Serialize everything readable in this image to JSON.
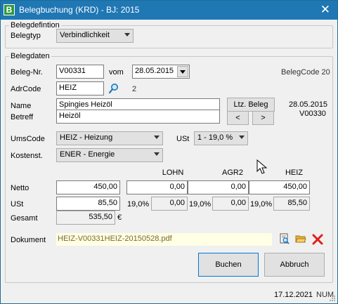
{
  "window": {
    "title": "Belegbuchung (KRD) - BJ: 2015",
    "close_glyph": "✕",
    "app_icon_letter": "B"
  },
  "belegdefinition": {
    "group_label": "Belegdefintion",
    "belegtyp_label": "Belegtyp",
    "belegtyp_value": "Verbindlichkeit"
  },
  "belegdaten": {
    "group_label": "Belegdaten",
    "belegnr_label": "Beleg-Nr.",
    "belegnr_value": "V00331",
    "vom_label": "vom",
    "vom_value": "28.05.2015",
    "belegcode": "BelegCode 20",
    "adrcode_label": "AdrCode",
    "adrcode_value": "HEIZ",
    "adrcode_count": "2",
    "name_label": "Name",
    "name_value": "Spingies Heizöl",
    "ltz_beleg_label": "Ltz. Beleg",
    "ltz_date": "28.05.2015",
    "ltz_nr": "V00330",
    "betreff_label": "Betreff",
    "betreff_value": "Heizöl",
    "prev_label": "<",
    "next_label": ">",
    "umscode_label": "UmsCode",
    "umscode_value": "HEIZ - Heizung",
    "ust_label": "USt",
    "ust_value": "1 - 19,0 %",
    "kostenst_label": "Kostenst.",
    "kostenst_value": "ENER - Energie",
    "columns": [
      "LOHN",
      "AGR2",
      "HEIZ"
    ],
    "netto_label": "Netto",
    "netto_total": "450,00",
    "netto_values": [
      "0,00",
      "0,00",
      "450,00"
    ],
    "ust_row_label": "USt",
    "ust_total": "85,50",
    "ust_rates": [
      "19,0%",
      "19,0%",
      "19,0%"
    ],
    "ust_values": [
      "0,00",
      "0,00",
      "85,50"
    ],
    "gesamt_label": "Gesamt",
    "gesamt_value": "535,50",
    "currency": "€",
    "dokument_label": "Dokument",
    "dokument_value": "HEIZ-V00331HEIZ-20150528.pdf"
  },
  "buttons": {
    "buchen": "Buchen",
    "abbruch": "Abbruch"
  },
  "status": {
    "date": "17.12.2021",
    "num": "NUM"
  }
}
